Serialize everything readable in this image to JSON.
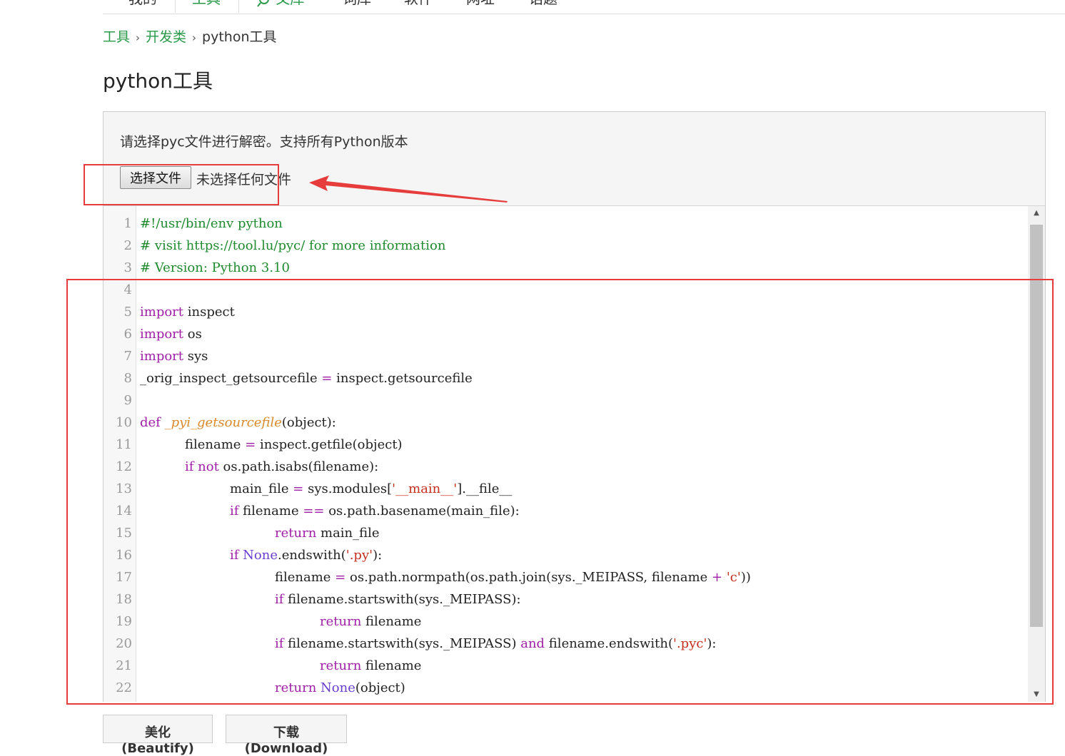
{
  "nav": {
    "tabs": [
      {
        "label": "我的"
      },
      {
        "label": "工具"
      },
      {
        "label": "文库"
      },
      {
        "label": "词库"
      },
      {
        "label": "软件"
      },
      {
        "label": "网址"
      },
      {
        "label": "话题"
      }
    ],
    "active_tab": "工具"
  },
  "breadcrumb": {
    "items": [
      "工具",
      "开发类"
    ],
    "current": "python工具",
    "separator": "›"
  },
  "page": {
    "title": "python工具"
  },
  "panel": {
    "description": "请选择pyc文件进行解密。支持所有Python版本",
    "file_button_label": "选择文件",
    "file_status": "未选择任何文件"
  },
  "editor": {
    "lines": [
      {
        "n": "1"
      },
      {
        "n": "2"
      },
      {
        "n": "3"
      },
      {
        "n": "4"
      },
      {
        "n": "5"
      },
      {
        "n": "6"
      },
      {
        "n": "7"
      },
      {
        "n": "8"
      },
      {
        "n": "9"
      },
      {
        "n": "10"
      },
      {
        "n": "11"
      },
      {
        "n": "12"
      },
      {
        "n": "13"
      },
      {
        "n": "14"
      },
      {
        "n": "15"
      },
      {
        "n": "16"
      },
      {
        "n": "17"
      },
      {
        "n": "18"
      },
      {
        "n": "19"
      },
      {
        "n": "20"
      },
      {
        "n": "21"
      },
      {
        "n": "22"
      }
    ],
    "code": {
      "l1": "#!/usr/bin/env python",
      "l2": "# visit https://tool.lu/pyc/ for more information",
      "l3": "# Version: Python 3.10",
      "l5_kw": "import",
      "l5_rest": " inspect",
      "l6_kw": "import",
      "l6_rest": " os",
      "l7_kw": "import",
      "l7_rest": " sys",
      "l8_a": "_orig_inspect_getsourcefile ",
      "l8_op": "=",
      "l8_b": " inspect.getsourcefile",
      "l10_kw": "def",
      "l10_fn": "_pyi_getsourcefile",
      "l10_rest": "(object):",
      "l11_a": "filename ",
      "l11_op": "=",
      "l11_b": " inspect.getfile(object)",
      "l12_kw": "if",
      "l12_kw2": "not",
      "l12_rest": " os.path.isabs(filename):",
      "l13_a": "main_file ",
      "l13_op": "=",
      "l13_b": " sys.modules[",
      "l13_st": "'__main__'",
      "l13_c": "].__file__",
      "l14_kw": "if",
      "l14_a": " filename ",
      "l14_op": "==",
      "l14_b": " os.path.basename(main_file):",
      "l15_kw": "return",
      "l15_rest": " main_file",
      "l16_kw": "if",
      "l16_co": "None",
      "l16_a": ".endswith(",
      "l16_st": "'.py'",
      "l16_b": "):",
      "l17_a": "filename ",
      "l17_op": "=",
      "l17_b": " os.path.normpath(os.path.join(sys._MEIPASS, filename ",
      "l17_op2": "+",
      "l17_st": "'c'",
      "l17_c": "))",
      "l18_kw": "if",
      "l18_rest": " filename.startswith(sys._MEIPASS):",
      "l19_kw": "return",
      "l19_rest": " filename",
      "l20_kw": "if",
      "l20_a": " filename.startswith(sys._MEIPASS) ",
      "l20_kw2": "and",
      "l20_b": " filename.endswith(",
      "l20_st": "'.pyc'",
      "l20_c": "):",
      "l21_kw": "return",
      "l21_rest": " filename",
      "l22_kw": "return",
      "l22_co": "None",
      "l22_rest": "(object)"
    }
  },
  "actions": {
    "beautify_label": "美化(Beautify)",
    "download_label": "下载(Download)"
  },
  "colors": {
    "accent_green": "#2a9a4a",
    "annotation_red": "#e63c3c",
    "comment": "#1f8a2e",
    "keyword": "#a020a8",
    "function": "#d98a2a",
    "string": "#c62f1e"
  }
}
